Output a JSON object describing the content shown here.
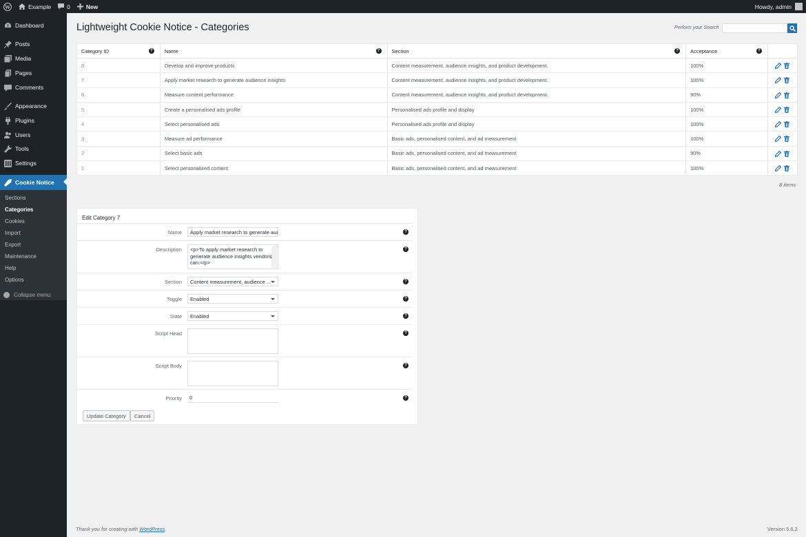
{
  "adminbar": {
    "site_name": "Example",
    "comments_count": "0",
    "new_label": "New",
    "howdy": "Howdy, admin"
  },
  "sidebar": {
    "items": [
      {
        "label": "Dashboard",
        "icon": "dashboard-icon"
      },
      {
        "label": "Posts",
        "icon": "pin-icon"
      },
      {
        "label": "Media",
        "icon": "media-icon"
      },
      {
        "label": "Pages",
        "icon": "pages-icon"
      },
      {
        "label": "Comments",
        "icon": "comment-icon"
      },
      {
        "label": "Appearance",
        "icon": "brush-icon"
      },
      {
        "label": "Plugins",
        "icon": "plugin-icon"
      },
      {
        "label": "Users",
        "icon": "users-icon"
      },
      {
        "label": "Tools",
        "icon": "wrench-icon"
      },
      {
        "label": "Settings",
        "icon": "settings-icon"
      },
      {
        "label": "Cookie Notice",
        "icon": "cookie-notice-icon"
      }
    ],
    "submenu": [
      "Sections",
      "Categories",
      "Cookies",
      "Import",
      "Export",
      "Maintenance",
      "Help",
      "Options"
    ],
    "collapse_label": "Collapse menu"
  },
  "page": {
    "title": "Lightweight Cookie Notice - Categories",
    "search_label": "Perform your Search",
    "search_value": "",
    "items_count": "8 items"
  },
  "table": {
    "headers": [
      "Category ID",
      "Name",
      "Section",
      "Acceptance"
    ],
    "rows": [
      {
        "id": "8",
        "name": "Develop and improve products",
        "section": "Content measurement, audience insights, and product development.",
        "acceptance": "100%"
      },
      {
        "id": "7",
        "name": "Apply market research to generate audience insights",
        "section": "Content measurement, audience insights, and product development.",
        "acceptance": "100%"
      },
      {
        "id": "6",
        "name": "Measure content performance",
        "section": "Content measurement, audience insights, and product development.",
        "acceptance": "90%"
      },
      {
        "id": "5",
        "name": "Create a personalised ads profile",
        "section": "Personalised ads profile and display",
        "acceptance": "100%"
      },
      {
        "id": "4",
        "name": "Select personalised ads",
        "section": "Personalised ads profile and display",
        "acceptance": "100%"
      },
      {
        "id": "3",
        "name": "Measure ad performance",
        "section": "Basic ads, personalised content, and ad measurement",
        "acceptance": "100%"
      },
      {
        "id": "2",
        "name": "Select basic ads",
        "section": "Basic ads, personalised content, and ad measurement",
        "acceptance": "90%"
      },
      {
        "id": "1",
        "name": "Select personalized content",
        "section": "Basic ads, personalised content, and ad measurement",
        "acceptance": "100%"
      }
    ]
  },
  "edit": {
    "title": "Edit Category 7",
    "fields": {
      "name_label": "Name",
      "name_value": "Apply market research to generate audi",
      "description_label": "Description",
      "description_lines": [
        "<p>To apply market research to",
        "generate audience insights vendors",
        "can:</p>"
      ],
      "section_label": "Section",
      "section_value": "Content measurement, audience ...",
      "toggle_label": "Toggle",
      "toggle_value": "Enabled",
      "state_label": "State",
      "state_value": "Enabled",
      "script_head_label": "Script Head",
      "script_body_label": "Script Body",
      "priority_label": "Priority",
      "priority_value": "0"
    },
    "update_button": "Update Category",
    "cancel_button": "Cancel"
  },
  "footer": {
    "thanks_prefix": "Thank you for creating with ",
    "wordpress_link": "WordPress",
    "thanks_suffix": ".",
    "version": "Version 5.6.2"
  },
  "colors": {
    "accent": "#2271b1",
    "sidebar_bg": "#1d2327",
    "submenu_bg": "#2c3338"
  }
}
